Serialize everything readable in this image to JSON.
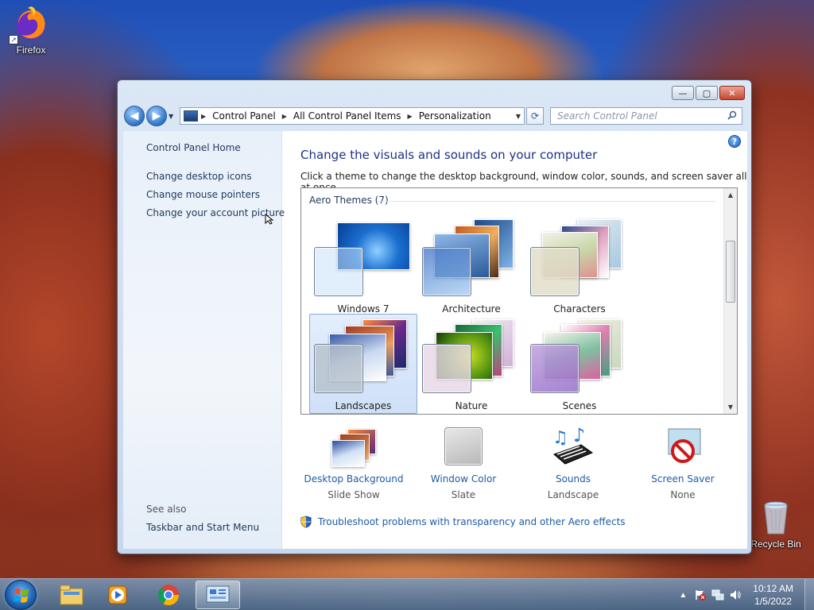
{
  "desktop": {
    "icons": [
      {
        "label": "Firefox"
      },
      {
        "label": "Recycle Bin"
      }
    ]
  },
  "window": {
    "caption_buttons": {
      "minimize": "—",
      "maximize": "▢",
      "close": "✕"
    },
    "nav": {
      "back": "◀",
      "forward": "▶",
      "breadcrumbs": [
        "Control Panel",
        "All Control Panel Items",
        "Personalization"
      ],
      "search_placeholder": "Search Control Panel"
    },
    "left_pane": {
      "home": "Control Panel Home",
      "links": [
        "Change desktop icons",
        "Change mouse pointers",
        "Change your account picture"
      ],
      "see_also_label": "See also",
      "see_also_links": [
        "Taskbar and Start Menu"
      ]
    },
    "main": {
      "help": "?",
      "title": "Change the visuals and sounds on your computer",
      "description": "Click a theme to change the desktop background, window color, sounds, and screen saver all at once.",
      "group_label": "Aero Themes (7)",
      "themes": [
        {
          "name": "Windows 7",
          "selected": false
        },
        {
          "name": "Architecture",
          "selected": false
        },
        {
          "name": "Characters",
          "selected": false
        },
        {
          "name": "Landscapes",
          "selected": true
        },
        {
          "name": "Nature",
          "selected": false
        },
        {
          "name": "Scenes",
          "selected": false
        }
      ],
      "bottom": [
        {
          "title": "Desktop Background",
          "subtitle": "Slide Show"
        },
        {
          "title": "Window Color",
          "subtitle": "Slate"
        },
        {
          "title": "Sounds",
          "subtitle": "Landscape"
        },
        {
          "title": "Screen Saver",
          "subtitle": "None"
        }
      ],
      "troubleshoot": "Troubleshoot problems with transparency and other Aero effects"
    }
  },
  "taskbar": {
    "clock_time": "10:12 AM",
    "clock_date": "1/5/2022",
    "pinned": [
      "file-explorer-icon",
      "media-player-icon",
      "chrome-icon",
      "control-panel-icon"
    ]
  },
  "colors": {
    "link": "#1e5ba8",
    "title": "#1e3287",
    "selection": "#cfe0f7"
  }
}
